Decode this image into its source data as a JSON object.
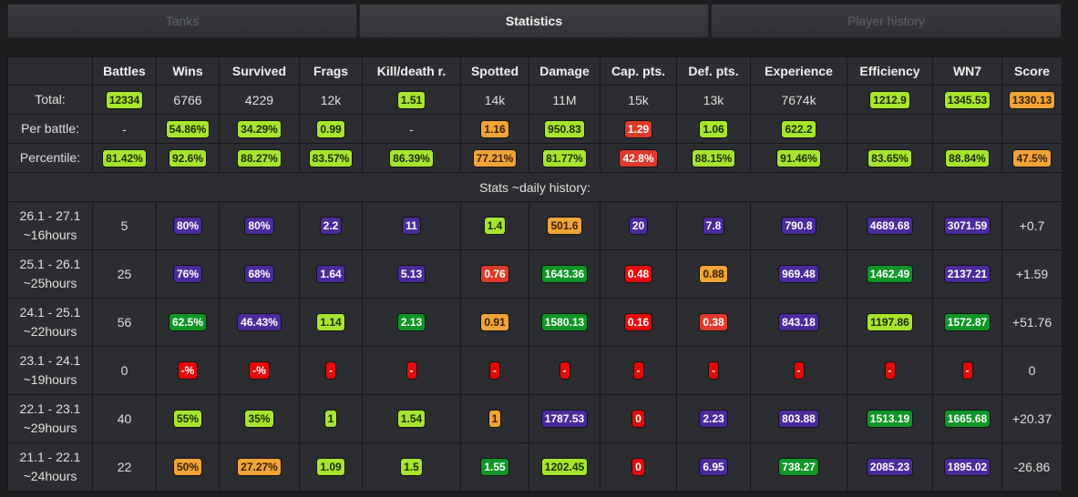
{
  "tabs": [
    {
      "label": "Tanks",
      "active": false
    },
    {
      "label": "Statistics",
      "active": true
    },
    {
      "label": "Player history",
      "active": false
    }
  ],
  "colors": {
    "lime": "#a6e52d",
    "green": "#0f9626",
    "purple": "#4b2a9c",
    "orange": "#f1a437",
    "red": "#dd3b2c",
    "bright_red": "#e80a0a"
  },
  "columns": [
    "",
    "Battles",
    "Wins",
    "Survived",
    "Frags",
    "Kill/death r.",
    "Spotted",
    "Damage",
    "Cap. pts.",
    "Def. pts.",
    "Experience",
    "Efficiency",
    "WN7",
    "Score"
  ],
  "summary_rows": [
    {
      "label": "Total:",
      "cells": [
        {
          "v": "12334",
          "c": "lime"
        },
        {
          "v": "6766"
        },
        {
          "v": "4229"
        },
        {
          "v": "12k"
        },
        {
          "v": "1.51",
          "c": "lime"
        },
        {
          "v": "14k"
        },
        {
          "v": "11M"
        },
        {
          "v": "15k"
        },
        {
          "v": "13k"
        },
        {
          "v": "7674k"
        },
        {
          "v": "1212.9",
          "c": "lime"
        },
        {
          "v": "1345.53",
          "c": "lime"
        },
        {
          "v": "1330.13",
          "c": "orange"
        }
      ]
    },
    {
      "label": "Per battle:",
      "cells": [
        {
          "v": "-"
        },
        {
          "v": "54.86%",
          "c": "lime"
        },
        {
          "v": "34.29%",
          "c": "lime"
        },
        {
          "v": "0.99",
          "c": "lime"
        },
        {
          "v": "-"
        },
        {
          "v": "1.16",
          "c": "orange"
        },
        {
          "v": "950.83",
          "c": "lime"
        },
        {
          "v": "1.29",
          "c": "red"
        },
        {
          "v": "1.06",
          "c": "lime"
        },
        {
          "v": "622.2",
          "c": "lime"
        },
        {
          "v": ""
        },
        {
          "v": ""
        },
        {
          "v": ""
        }
      ]
    },
    {
      "label": "Percentile:",
      "cells": [
        {
          "v": "81.42%",
          "c": "lime"
        },
        {
          "v": "92.6%",
          "c": "lime"
        },
        {
          "v": "88.27%",
          "c": "lime"
        },
        {
          "v": "83.57%",
          "c": "lime"
        },
        {
          "v": "86.39%",
          "c": "lime"
        },
        {
          "v": "77.21%",
          "c": "orange"
        },
        {
          "v": "81.77%",
          "c": "lime"
        },
        {
          "v": "42.8%",
          "c": "red"
        },
        {
          "v": "88.15%",
          "c": "lime"
        },
        {
          "v": "91.46%",
          "c": "lime"
        },
        {
          "v": "83.65%",
          "c": "lime"
        },
        {
          "v": "88.84%",
          "c": "lime"
        },
        {
          "v": "47.5%",
          "c": "orange"
        }
      ]
    }
  ],
  "history_title": "Stats ~daily history:",
  "history_rows": [
    {
      "range": "26.1 - 27.1",
      "duration": "~16hours",
      "cells": [
        {
          "v": "5"
        },
        {
          "v": "80%",
          "c": "purple"
        },
        {
          "v": "80%",
          "c": "purple"
        },
        {
          "v": "2.2",
          "c": "purple"
        },
        {
          "v": "11",
          "c": "purple"
        },
        {
          "v": "1.4",
          "c": "lime"
        },
        {
          "v": "501.6",
          "c": "orange"
        },
        {
          "v": "20",
          "c": "purple"
        },
        {
          "v": "7.8",
          "c": "purple"
        },
        {
          "v": "790.8",
          "c": "purple"
        },
        {
          "v": "4689.68",
          "c": "purple"
        },
        {
          "v": "3071.59",
          "c": "purple"
        },
        {
          "v": "+0.7"
        }
      ]
    },
    {
      "range": "25.1 - 26.1",
      "duration": "~25hours",
      "cells": [
        {
          "v": "25"
        },
        {
          "v": "76%",
          "c": "purple"
        },
        {
          "v": "68%",
          "c": "purple"
        },
        {
          "v": "1.64",
          "c": "purple"
        },
        {
          "v": "5.13",
          "c": "purple"
        },
        {
          "v": "0.76",
          "c": "red"
        },
        {
          "v": "1643.36",
          "c": "green"
        },
        {
          "v": "0.48",
          "c": "bred"
        },
        {
          "v": "0.88",
          "c": "orange"
        },
        {
          "v": "969.48",
          "c": "purple"
        },
        {
          "v": "1462.49",
          "c": "green"
        },
        {
          "v": "2137.21",
          "c": "purple"
        },
        {
          "v": "+1.59"
        }
      ]
    },
    {
      "range": "24.1 - 25.1",
      "duration": "~22hours",
      "cells": [
        {
          "v": "56"
        },
        {
          "v": "62.5%",
          "c": "green"
        },
        {
          "v": "46.43%",
          "c": "purple"
        },
        {
          "v": "1.14",
          "c": "lime"
        },
        {
          "v": "2.13",
          "c": "green"
        },
        {
          "v": "0.91",
          "c": "orange"
        },
        {
          "v": "1580.13",
          "c": "green"
        },
        {
          "v": "0.16",
          "c": "bred"
        },
        {
          "v": "0.38",
          "c": "red"
        },
        {
          "v": "843.18",
          "c": "purple"
        },
        {
          "v": "1197.86",
          "c": "lime"
        },
        {
          "v": "1572.87",
          "c": "green"
        },
        {
          "v": "+51.76"
        }
      ]
    },
    {
      "range": "23.1 - 24.1",
      "duration": "~19hours",
      "cells": [
        {
          "v": "0"
        },
        {
          "v": "-%",
          "c": "bred"
        },
        {
          "v": "-%",
          "c": "bred"
        },
        {
          "v": "-",
          "c": "bred"
        },
        {
          "v": "-",
          "c": "bred"
        },
        {
          "v": "-",
          "c": "bred"
        },
        {
          "v": "-",
          "c": "bred"
        },
        {
          "v": "-",
          "c": "bred"
        },
        {
          "v": "-",
          "c": "bred"
        },
        {
          "v": "-",
          "c": "bred"
        },
        {
          "v": "-",
          "c": "bred"
        },
        {
          "v": "-",
          "c": "bred"
        },
        {
          "v": "0"
        }
      ]
    },
    {
      "range": "22.1 - 23.1",
      "duration": "~29hours",
      "cells": [
        {
          "v": "40"
        },
        {
          "v": "55%",
          "c": "lime"
        },
        {
          "v": "35%",
          "c": "lime"
        },
        {
          "v": "1",
          "c": "lime"
        },
        {
          "v": "1.54",
          "c": "lime"
        },
        {
          "v": "1",
          "c": "orange"
        },
        {
          "v": "1787.53",
          "c": "purple"
        },
        {
          "v": "0",
          "c": "bred"
        },
        {
          "v": "2.23",
          "c": "purple"
        },
        {
          "v": "803.88",
          "c": "purple"
        },
        {
          "v": "1513.19",
          "c": "green"
        },
        {
          "v": "1665.68",
          "c": "green"
        },
        {
          "v": "+20.37"
        }
      ]
    },
    {
      "range": "21.1 - 22.1",
      "duration": "~24hours",
      "cells": [
        {
          "v": "22"
        },
        {
          "v": "50%",
          "c": "orange"
        },
        {
          "v": "27.27%",
          "c": "orange"
        },
        {
          "v": "1.09",
          "c": "lime"
        },
        {
          "v": "1.5",
          "c": "lime"
        },
        {
          "v": "1.55",
          "c": "green"
        },
        {
          "v": "1202.45",
          "c": "lime"
        },
        {
          "v": "0",
          "c": "bred"
        },
        {
          "v": "6.95",
          "c": "purple"
        },
        {
          "v": "738.27",
          "c": "green"
        },
        {
          "v": "2085.23",
          "c": "purple"
        },
        {
          "v": "1895.02",
          "c": "purple"
        },
        {
          "v": "-26.86"
        }
      ]
    }
  ]
}
